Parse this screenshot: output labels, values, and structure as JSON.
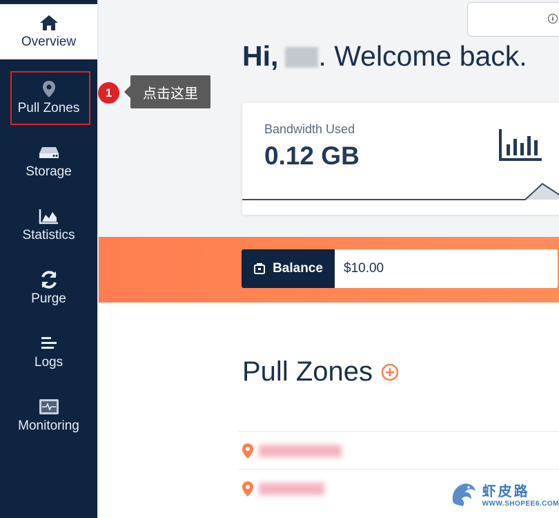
{
  "sidebar": {
    "items": [
      {
        "key": "overview",
        "label": "Overview",
        "icon": "home-icon",
        "active": true
      },
      {
        "key": "pull-zones",
        "label": "Pull Zones",
        "icon": "map-pin-icon",
        "active": false
      },
      {
        "key": "storage",
        "label": "Storage",
        "icon": "hard-drive-icon",
        "active": false
      },
      {
        "key": "statistics",
        "label": "Statistics",
        "icon": "area-chart-icon",
        "active": false
      },
      {
        "key": "purge",
        "label": "Purge",
        "icon": "refresh-icon",
        "active": false
      },
      {
        "key": "logs",
        "label": "Logs",
        "icon": "list-lines-icon",
        "active": false
      },
      {
        "key": "monitoring",
        "label": "Monitoring",
        "icon": "monitor-pulse-icon",
        "active": false
      }
    ]
  },
  "annotation": {
    "step_number": "1",
    "tooltip": "点击这里",
    "highlight_color": "#e02128"
  },
  "header": {
    "greeting": "Hi,",
    "welcome": ". Welcome back."
  },
  "bandwidth": {
    "label": "Bandwidth Used",
    "value": "0.12 GB"
  },
  "balance": {
    "label": "Balance",
    "value": "$10.00"
  },
  "pull_zones": {
    "heading": "Pull Zones"
  },
  "watermark": {
    "chinese": "虾皮路",
    "url": "WWW.SHOPEE6.COM"
  },
  "colors": {
    "sidebar_bg": "#0f2440",
    "accent_orange": "#ff7e50",
    "pin_orange": "#ff7e50",
    "text_dark": "#1c2f4a"
  }
}
